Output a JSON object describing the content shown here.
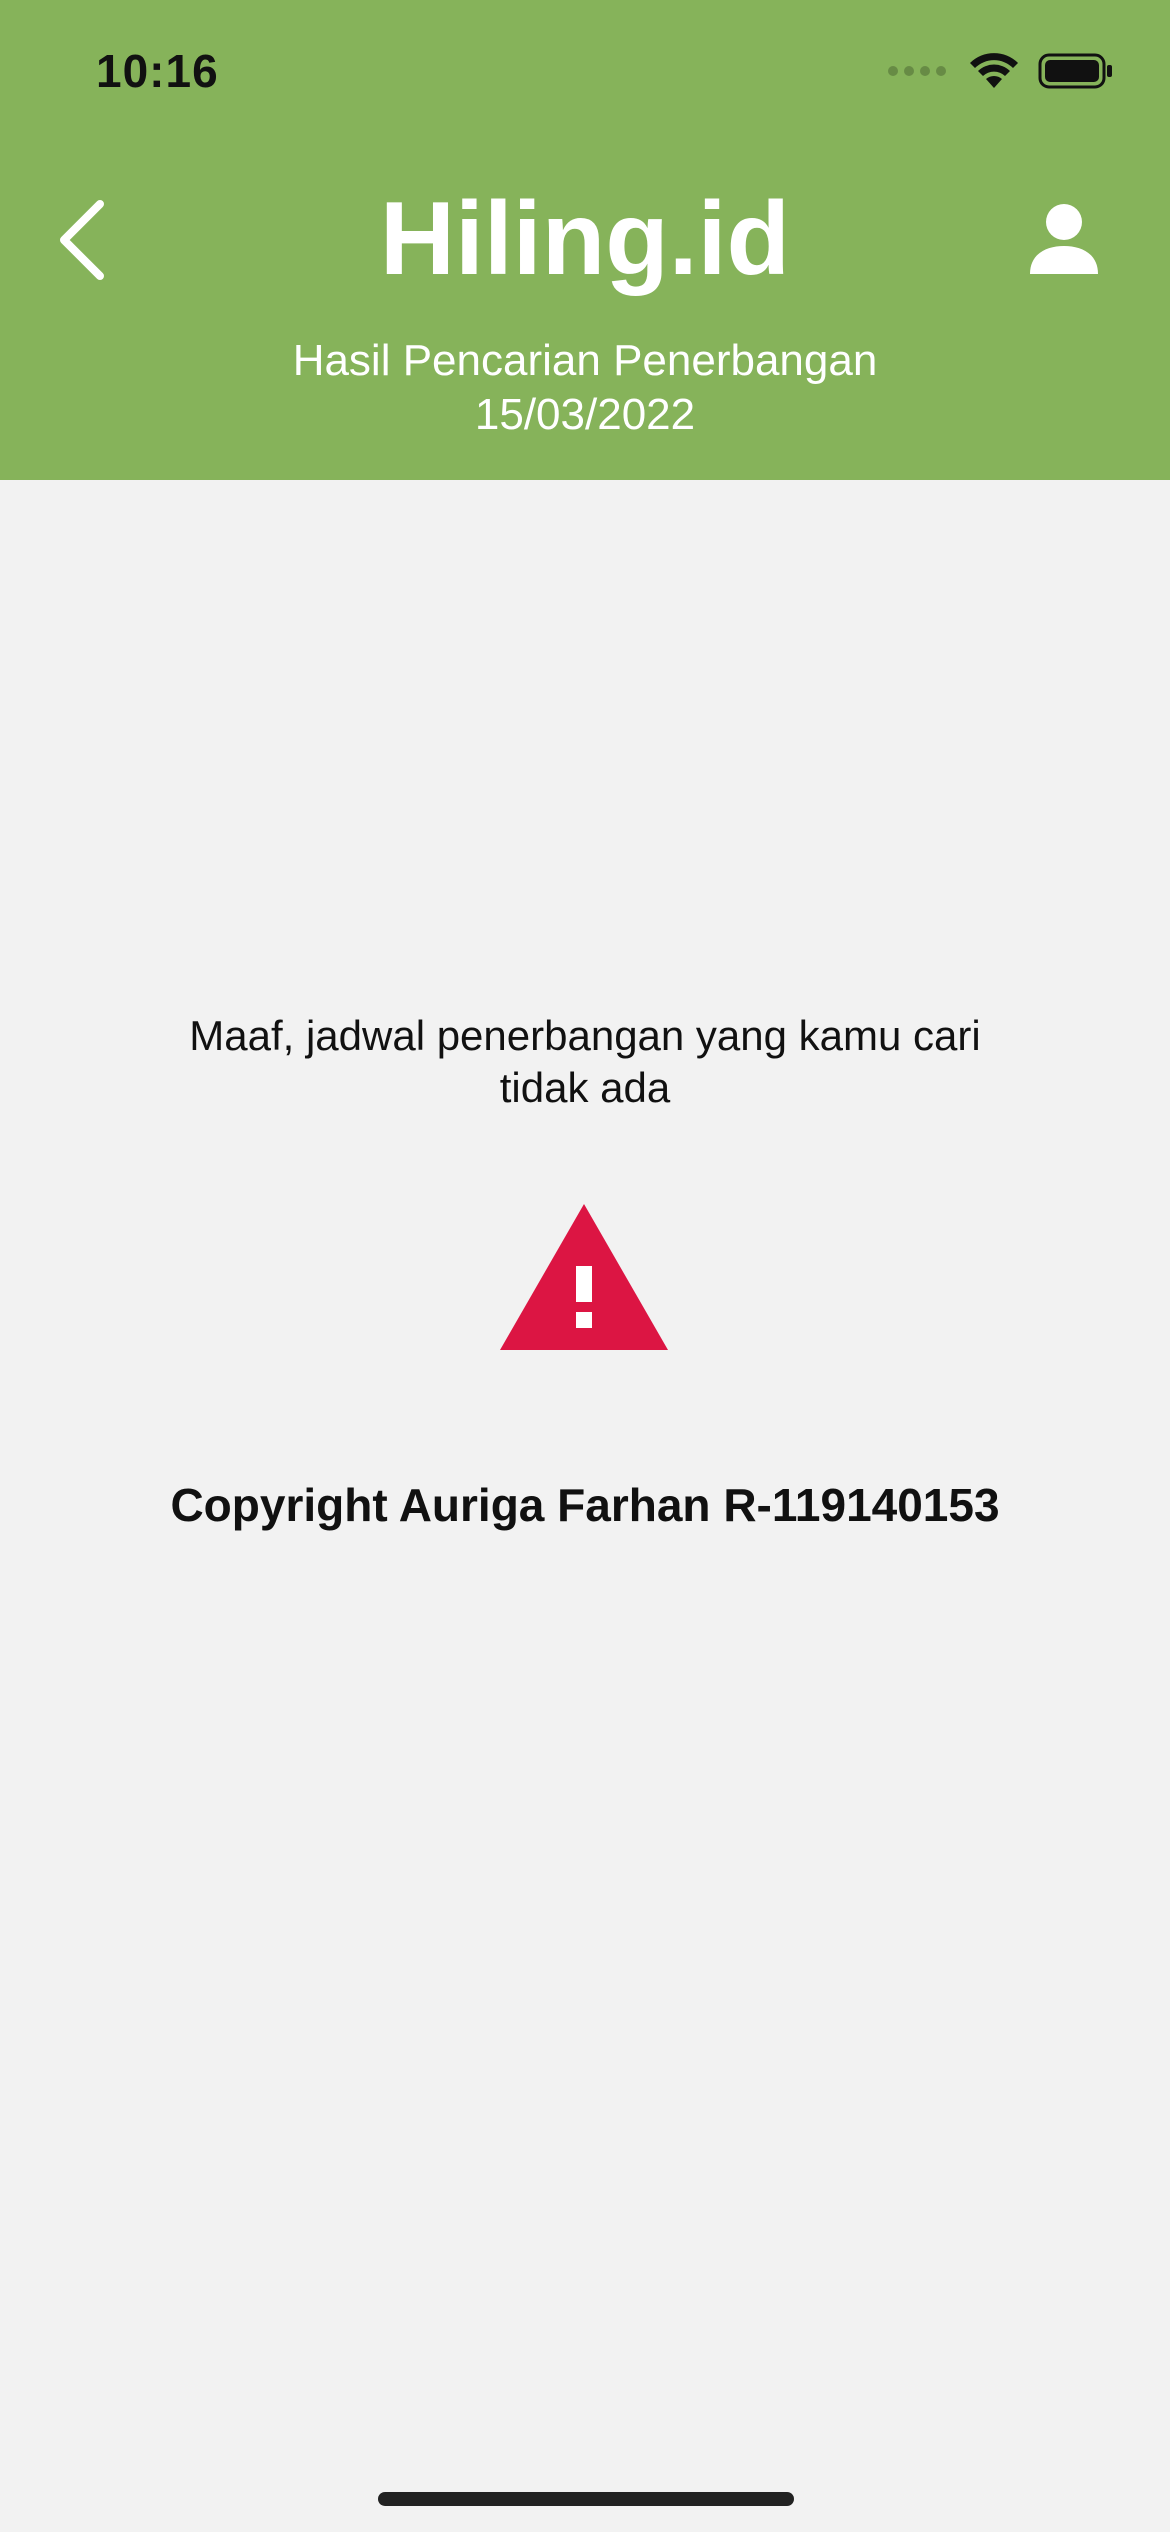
{
  "status_bar": {
    "time": "10:16",
    "icons": [
      "signal-icon",
      "wifi-icon",
      "battery-icon"
    ]
  },
  "header": {
    "title": "Hiling.id",
    "subtitle_line1": "Hasil Pencarian Penerbangan",
    "subtitle_line2": "15/03/2022",
    "back_icon": "chevron-left-icon",
    "profile_icon": "person-icon",
    "background_color": "#86b35a"
  },
  "main": {
    "message": "Maaf, jadwal penerbangan yang kamu cari tidak ada",
    "warning_icon": "warning-triangle-icon",
    "warning_color": "#dc1543",
    "copyright": "Copyright Auriga Farhan R-119140153"
  },
  "colors": {
    "page_background": "#f2f2f2",
    "text": "#111111"
  }
}
